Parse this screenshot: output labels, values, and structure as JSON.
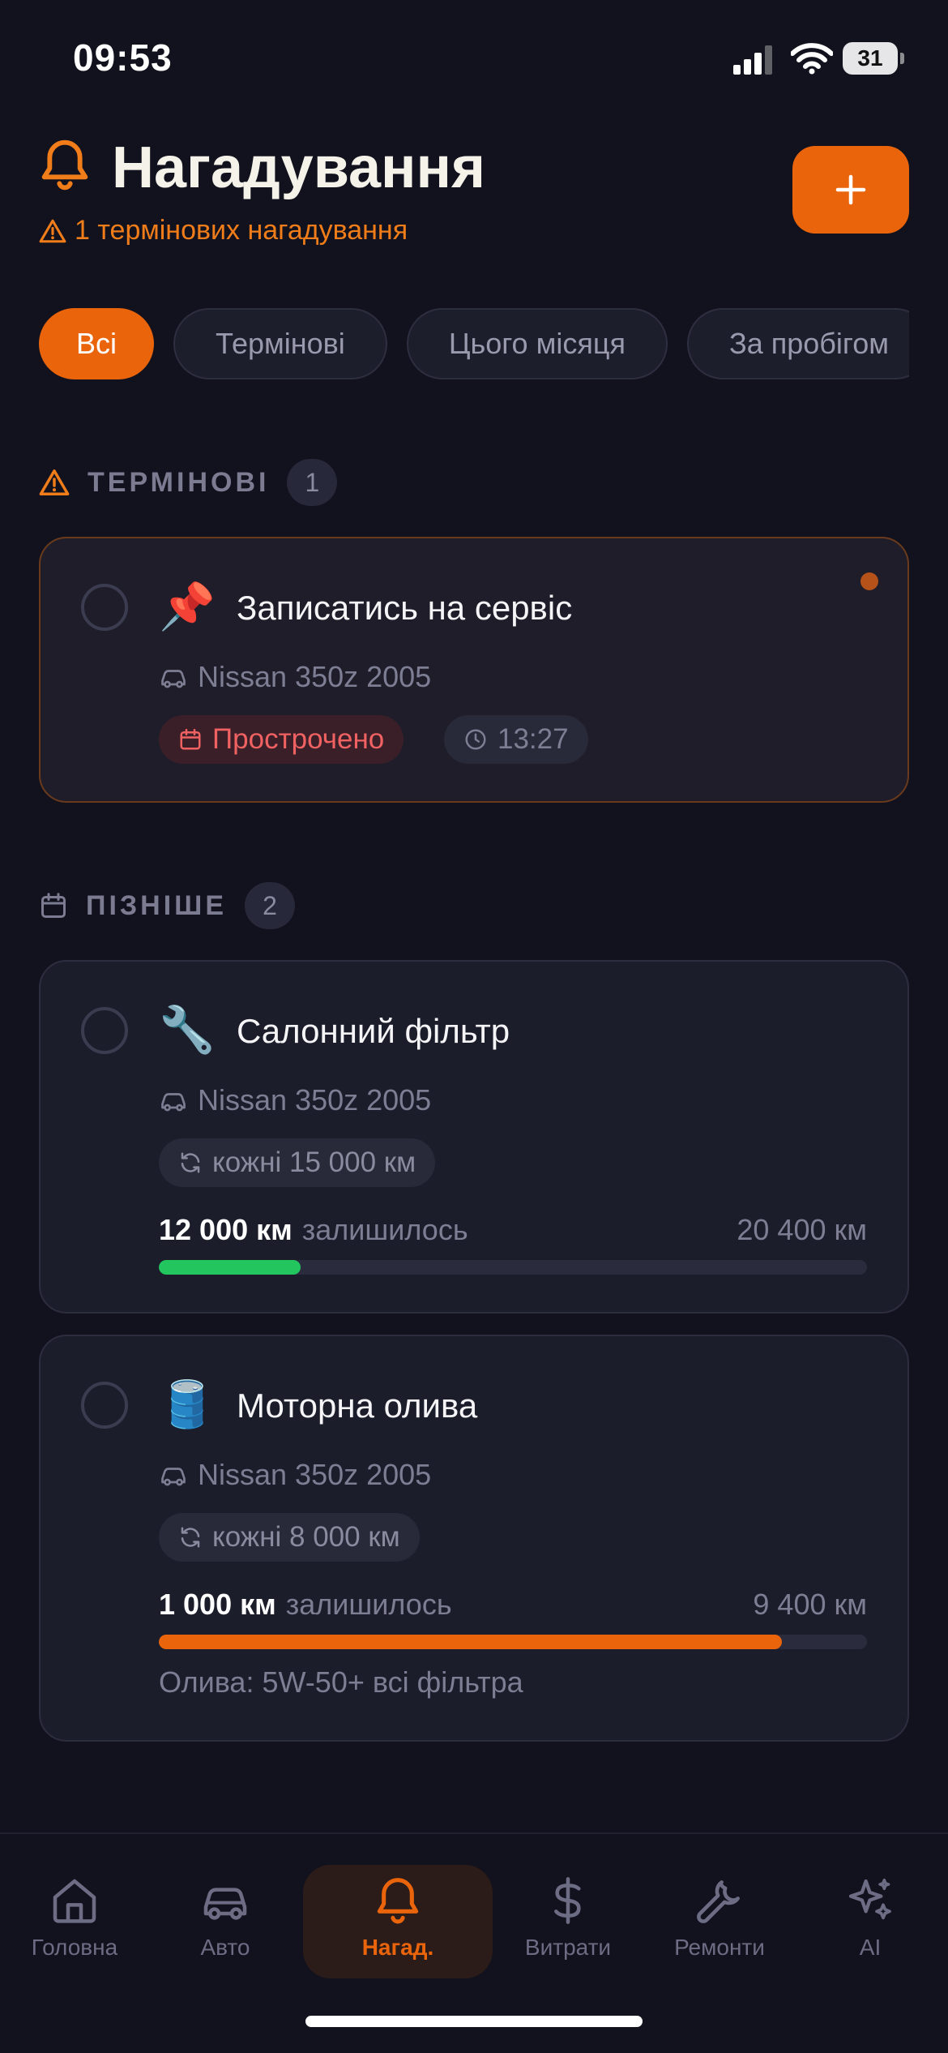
{
  "status_bar": {
    "time": "09:53",
    "battery": "31"
  },
  "header": {
    "title": "Нагадування",
    "subtitle": "1 термінових нагадування",
    "add_label": "+"
  },
  "filters": [
    "Всі",
    "Термінові",
    "Цього місяця",
    "За пробігом"
  ],
  "sections": {
    "urgent": {
      "label": "ТЕРМІНОВІ",
      "count": "1"
    },
    "later": {
      "label": "ПІЗНІШЕ",
      "count": "2"
    }
  },
  "reminders": [
    {
      "emoji": "📌",
      "title": "Записатись на сервіс",
      "car": "Nissan 350z 2005",
      "status": "Прострочено",
      "time": "13:27"
    },
    {
      "emoji": "🔧",
      "title": "Салонний фільтр",
      "car": "Nissan 350z 2005",
      "interval": "кожні 15 000 км",
      "remaining_value": "12 000 км",
      "remaining_label": "залишилось",
      "target": "20 400 км",
      "progress": 0.2,
      "progress_color": "#22c55e"
    },
    {
      "emoji": "🛢️",
      "title": "Моторна олива",
      "car": "Nissan 350z 2005",
      "interval": "кожні 8 000 км",
      "remaining_value": "1 000 км",
      "remaining_label": "залишилось",
      "target": "9 400 км",
      "progress": 0.88,
      "progress_color": "#ea640c",
      "note": "Олива: 5W-50+ всі фільтра"
    }
  ],
  "nav": {
    "items": [
      {
        "label": "Головна",
        "icon": "home-icon"
      },
      {
        "label": "Авто",
        "icon": "car-icon"
      },
      {
        "label": "Нагад.",
        "icon": "bell-icon"
      },
      {
        "label": "Витрати",
        "icon": "dollar-icon"
      },
      {
        "label": "Ремонти",
        "icon": "wrench-icon"
      },
      {
        "label": "AI",
        "icon": "sparkles-icon"
      }
    ],
    "active": "Нагад."
  },
  "colors": {
    "accent": "#ea640c",
    "background": "#11121d",
    "card": "#1c1d2b",
    "overdue": "#f06262",
    "ok": "#22c55e"
  }
}
